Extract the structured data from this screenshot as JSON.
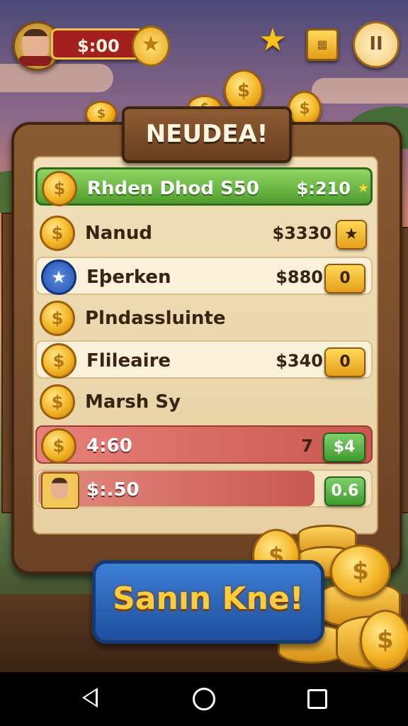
{
  "topbar": {
    "balance": "$:00",
    "balance_icon": "star-icon",
    "star_icon": "star-icon",
    "card_icon": "card-icon",
    "pause_label": "II"
  },
  "board": {
    "title": "NEUDEA!",
    "rows": [
      {
        "name": "Rhden Dhod S50",
        "amount": "$:210",
        "badge": "",
        "style": "highlight-green"
      },
      {
        "name": "Nanud",
        "amount": "$3330",
        "badge": "★",
        "style": "plain"
      },
      {
        "name": "Eþerken",
        "amount": "$880",
        "badge": "0",
        "style": "light",
        "icon": "star-icon"
      },
      {
        "name": "Plndassluinte",
        "amount": "",
        "badge": "",
        "style": "plain"
      },
      {
        "name": "Flileaire",
        "amount": "$340",
        "badge": "0",
        "style": "light"
      },
      {
        "name": "Marsh Sy",
        "amount": "",
        "badge": "",
        "style": "plain"
      },
      {
        "name": "4:60",
        "amount": "7",
        "badge": "$4",
        "style": "highlight-red"
      },
      {
        "name": "$:.50",
        "amount": "",
        "badge": "0.6",
        "style": "player",
        "icon": "avatar"
      }
    ]
  },
  "cta": {
    "label": "Sanın Kne!"
  },
  "coin_symbol": "$",
  "colors": {
    "accent_gold": "#f3b323",
    "board_wood": "#6b4124",
    "cta_blue": "#1f4e9c",
    "row_green": "#6fbe46",
    "row_red": "#d36a62"
  },
  "navbar": {
    "back_icon": "back-icon",
    "home_icon": "home-icon",
    "recents_icon": "recents-icon"
  }
}
